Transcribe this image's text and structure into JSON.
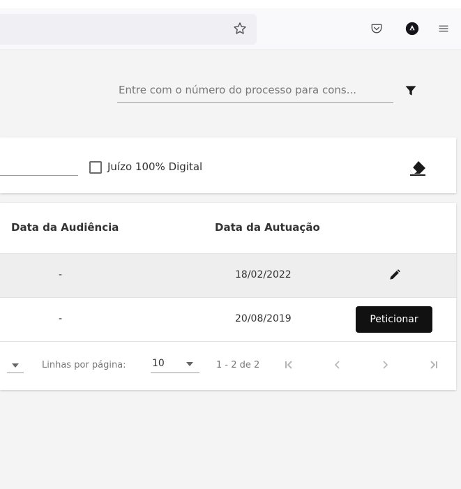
{
  "browser": {
    "icons": {
      "star": "star-icon",
      "pocket": "pocket-icon",
      "account": "account-icon",
      "menu": "menu-icon"
    }
  },
  "search": {
    "placeholder": "Entre com o número do processo para cons...",
    "value": ""
  },
  "filters": {
    "digital_checkbox_label": "Juízo 100% Digital",
    "digital_checked": false
  },
  "table": {
    "columns": [
      "Data da Audiência",
      "Data da Autuação"
    ],
    "rows": [
      {
        "audiencia": "-",
        "autuacao": "18/02/2022"
      },
      {
        "audiencia": "-",
        "autuacao": "20/08/2019"
      }
    ],
    "tooltip": "Peticionar"
  },
  "paginator": {
    "rows_label": "Linhas por página:",
    "rows_per_page": "10",
    "range": "1 - 2 de 2"
  },
  "colors": {
    "page_bg": "#f4f4f5",
    "card_bg": "#ffffff",
    "row_highlight": "#eeeeee",
    "tooltip_bg": "#111111",
    "icon_dark": "#222222",
    "muted_text": "#777777"
  }
}
